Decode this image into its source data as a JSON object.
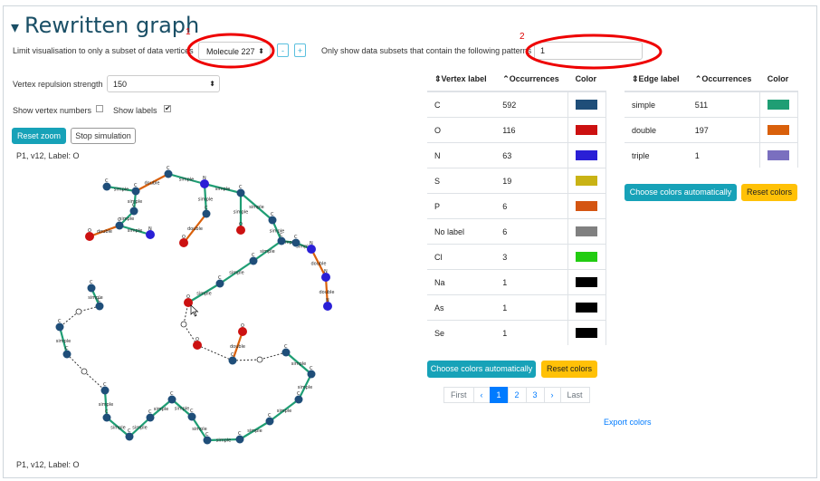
{
  "header": {
    "title": "Rewritten graph",
    "collapse_icon": "▾"
  },
  "annotations": {
    "marker1": "1",
    "marker2": "2"
  },
  "controls": {
    "limit_label": "Limit visualisation to only a subset of data vertices",
    "molecule_select_value": "Molecule 227",
    "minus_label": "-",
    "plus_label": "+",
    "patterns_label": "Only show data subsets that contain the following patterns",
    "patterns_value": "1",
    "repulsion_label": "Vertex repulsion strength",
    "repulsion_value": "150",
    "show_vertex_numbers_label": "Show vertex numbers",
    "show_vertex_numbers_checked": false,
    "show_labels_label": "Show labels",
    "show_labels_checked": true,
    "reset_zoom_label": "Reset zoom",
    "stop_simulation_label": "Stop simulation",
    "hover_info_top": "P1, v12, Label: O",
    "hover_info_bottom": "P1, v12, Label: O"
  },
  "vertex_table": {
    "headers": {
      "label": "⇕Vertex label",
      "occurrences": "⌃Occurrences",
      "color": "Color"
    },
    "rows": [
      {
        "label": "C",
        "occurrences": "592",
        "color": "#1f4e79"
      },
      {
        "label": "O",
        "occurrences": "116",
        "color": "#cc1111"
      },
      {
        "label": "N",
        "occurrences": "63",
        "color": "#2a1fd6"
      },
      {
        "label": "S",
        "occurrences": "19",
        "color": "#c9b315"
      },
      {
        "label": "P",
        "occurrences": "6",
        "color": "#d45512"
      },
      {
        "label": "No label",
        "occurrences": "6",
        "color": "#808080"
      },
      {
        "label": "Cl",
        "occurrences": "3",
        "color": "#22cc11"
      },
      {
        "label": "Na",
        "occurrences": "1",
        "color": "#000000"
      },
      {
        "label": "As",
        "occurrences": "1",
        "color": "#000000"
      },
      {
        "label": "Se",
        "occurrences": "1",
        "color": "#000000"
      }
    ],
    "choose_colors_label": "Choose colors automatically",
    "reset_colors_label": "Reset colors",
    "pagination": {
      "first": "First",
      "prev": "‹",
      "pages": [
        "1",
        "2",
        "3"
      ],
      "active_page": "1",
      "next": "›",
      "last": "Last"
    },
    "export_label": "Export colors"
  },
  "edge_table": {
    "headers": {
      "label": "⇕Edge label",
      "occurrences": "⌃Occurrences",
      "color": "Color"
    },
    "rows": [
      {
        "label": "simple",
        "occurrences": "511",
        "color": "#1f9e74"
      },
      {
        "label": "double",
        "occurrences": "197",
        "color": "#d9600b"
      },
      {
        "label": "triple",
        "occurrences": "1",
        "color": "#7a6fbf"
      }
    ],
    "choose_colors_label": "Choose colors automatically",
    "reset_colors_label": "Reset colors"
  },
  "graph": {
    "vertex_colors": {
      "C": "#1f4e79",
      "O": "#cc1111",
      "N": "#2a1fd6"
    },
    "edge_colors": {
      "simple": "#1f9e74",
      "double": "#d9600b"
    },
    "vertex_label_text": {
      "C": "C",
      "O": "O",
      "N": "N"
    },
    "edge_label_text": {
      "simple": "simple",
      "double": "double"
    }
  }
}
